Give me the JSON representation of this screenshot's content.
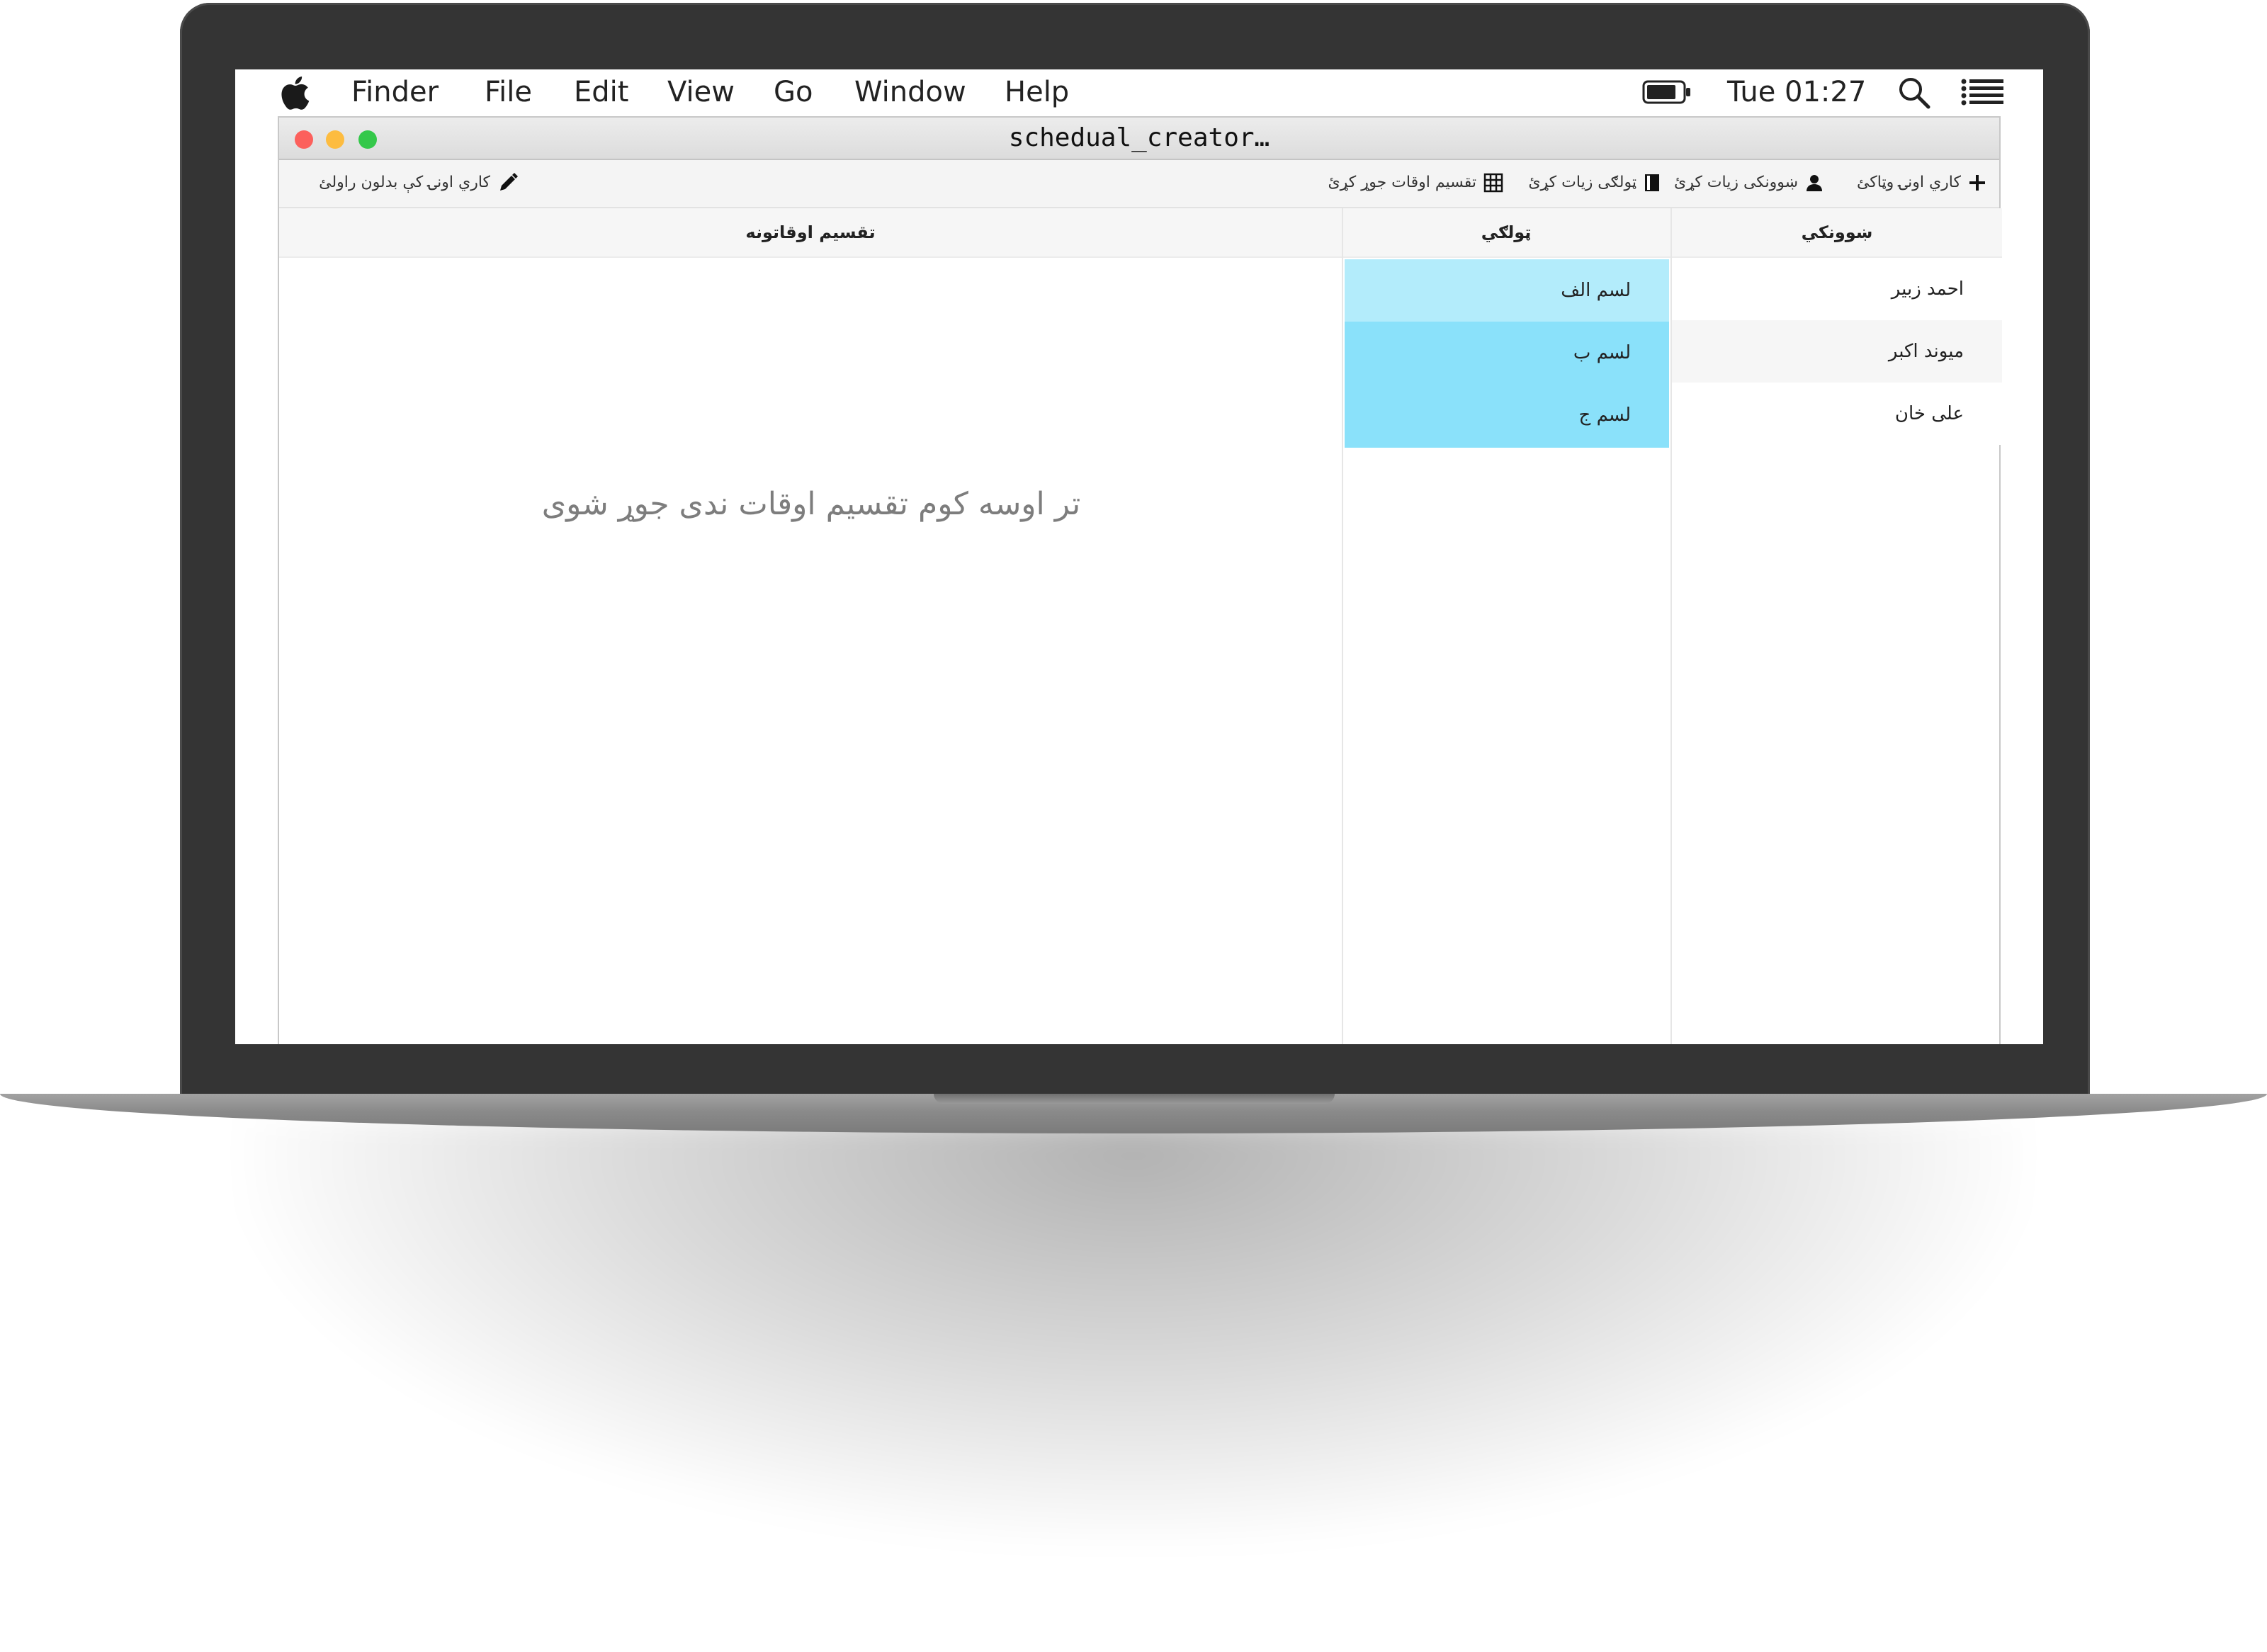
{
  "menubar": {
    "apple_icon": "apple-logo",
    "items": [
      "Finder",
      "File",
      "Edit",
      "View",
      "Go",
      "Window",
      "Help"
    ],
    "clock": "Tue 01:27",
    "right_icons": [
      "battery-icon",
      "search-icon",
      "list-icon"
    ]
  },
  "window": {
    "title": "schedual_creator…",
    "traffic_colors": {
      "close": "#fc605c",
      "minimize": "#fdbc40",
      "zoom": "#34c84a"
    }
  },
  "toolbar": {
    "add_work_day": "کاري اونۍ وټاکئ",
    "create_teacher": "ښوونکی زیات کړئ",
    "create_class": "ټولګی زیات کړئ",
    "create_schedule": "تقسیم اوقات جوړ کړئ",
    "change_work_days": "کاري اونۍ کې بدلون راولئ"
  },
  "columns": {
    "teachers": "ښوونکي",
    "classes": "ټولګي",
    "schedules": "تقسیم اوقاتونه"
  },
  "teachers": [
    "احمد زبیر",
    "میوند اکبر",
    "علی خان"
  ],
  "classes": [
    "لسم الف",
    "لسم ب",
    "لسم ج"
  ],
  "schedule_placeholder": "تر اوسه کوم تقسیم اوقات ندی جوړ شوی",
  "colors": {
    "class_selected": "#b3ecfb",
    "class_row": "#8ae1fa",
    "teacher_alt_row": "#f6f6f6"
  }
}
